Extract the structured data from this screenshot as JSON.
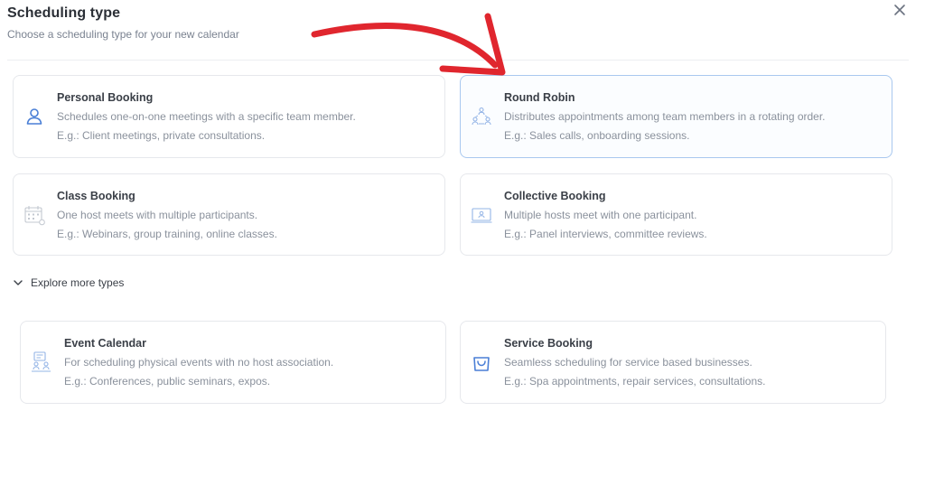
{
  "header": {
    "title": "Scheduling type",
    "subtitle": "Choose a scheduling type for your new calendar"
  },
  "icons": {
    "close": "close-icon",
    "chevron": "chevron-down-icon"
  },
  "colors": {
    "accent": "#4a7fd6",
    "selected_border": "#a9c8ef",
    "annotation_arrow": "#e0262e"
  },
  "cards": {
    "personal": {
      "title": "Personal Booking",
      "description": "Schedules one-on-one meetings with a specific team member.",
      "example": "E.g.: Client meetings, private consultations."
    },
    "round_robin": {
      "title": "Round Robin",
      "description": "Distributes appointments among team members in a rotating order.",
      "example": "E.g.: Sales calls, onboarding sessions.",
      "selected": true
    },
    "class": {
      "title": "Class Booking",
      "description": "One host meets with multiple participants.",
      "example": "E.g.: Webinars, group training, online classes."
    },
    "collective": {
      "title": "Collective Booking",
      "description": "Multiple hosts meet with one participant.",
      "example": "E.g.: Panel interviews, committee reviews."
    }
  },
  "explore": {
    "label": "Explore more types"
  },
  "more_cards": {
    "event": {
      "title": "Event Calendar",
      "description": "For scheduling physical events with no host association.",
      "example": "E.g.: Conferences, public seminars, expos."
    },
    "service": {
      "title": "Service Booking",
      "description": "Seamless scheduling for service based businesses.",
      "example": "E.g.: Spa appointments, repair services, consultations."
    }
  }
}
